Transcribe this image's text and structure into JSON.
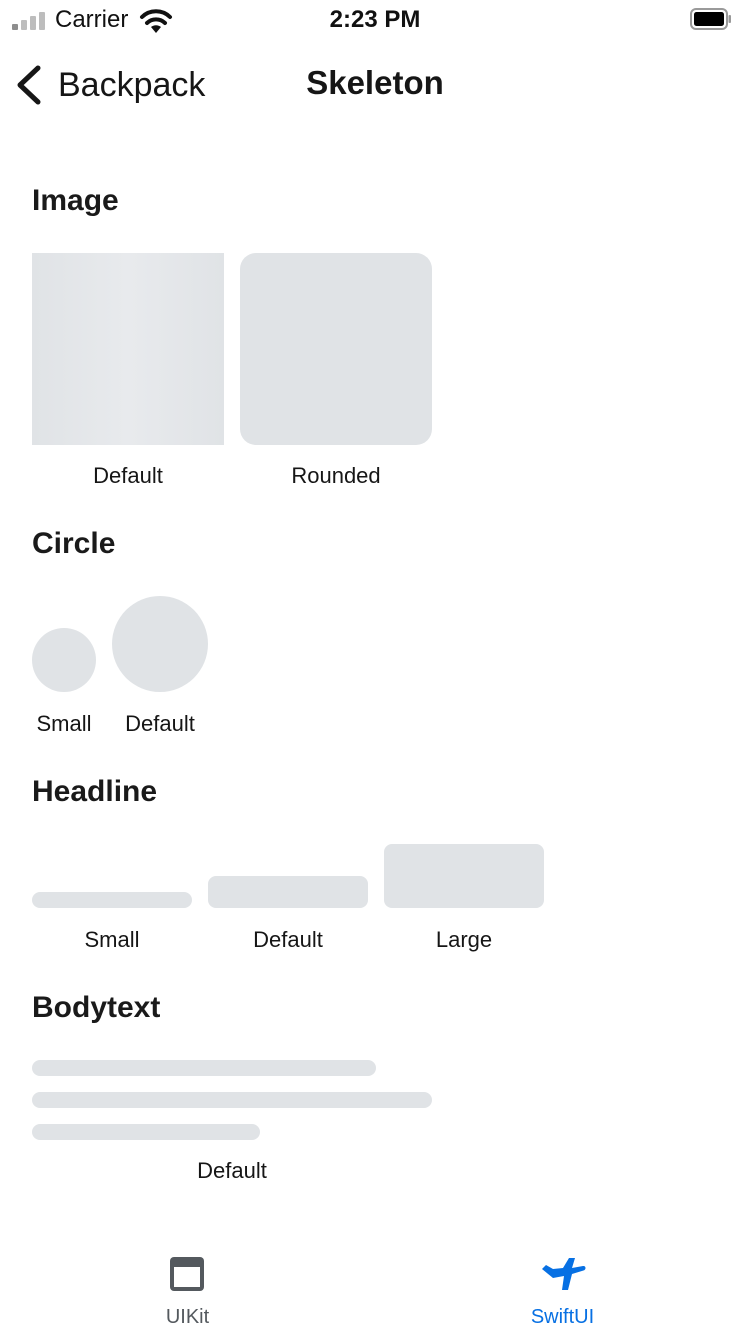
{
  "status_bar": {
    "carrier": "Carrier",
    "time": "2:23 PM",
    "signal_bars_active": 1,
    "signal_bars_total": 4
  },
  "nav": {
    "back_label": "Backpack",
    "title": "Skeleton",
    "back_icon": "chevron-left-icon"
  },
  "sections": {
    "image": {
      "title": "Image",
      "labels": [
        "Default",
        "Rounded"
      ]
    },
    "circle": {
      "title": "Circle",
      "labels": [
        "Small",
        "Default"
      ]
    },
    "headline": {
      "title": "Headline",
      "labels": [
        "Small",
        "Default",
        "Large"
      ]
    },
    "bodytext": {
      "title": "Bodytext",
      "label": "Default"
    }
  },
  "tab_bar": {
    "tabs": [
      {
        "label": "UIKit",
        "icon": "window-icon",
        "selected": false
      },
      {
        "label": "SwiftUI",
        "icon": "airplane-icon",
        "selected": true
      }
    ]
  },
  "colors": {
    "skeleton": "#e0e3e6",
    "accent": "#0770e3",
    "text": "#161616",
    "tab_inactive": "#54595e"
  }
}
